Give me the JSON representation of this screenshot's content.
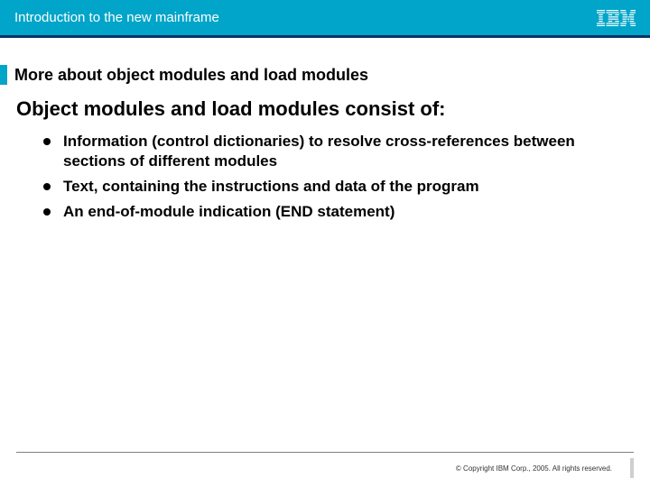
{
  "header": {
    "title": "Introduction to the new mainframe",
    "logo_name": "ibm-logo"
  },
  "subtitle": "More about object modules and load modules",
  "lead": "Object modules and load modules consist of:",
  "bullets": [
    "Information (control dictionaries) to resolve cross-references between sections of different modules",
    "Text, containing the instructions and data of the program",
    "An end-of-module indication (END statement)"
  ],
  "footer": {
    "copyright": "© Copyright IBM Corp., 2005. All rights reserved."
  }
}
